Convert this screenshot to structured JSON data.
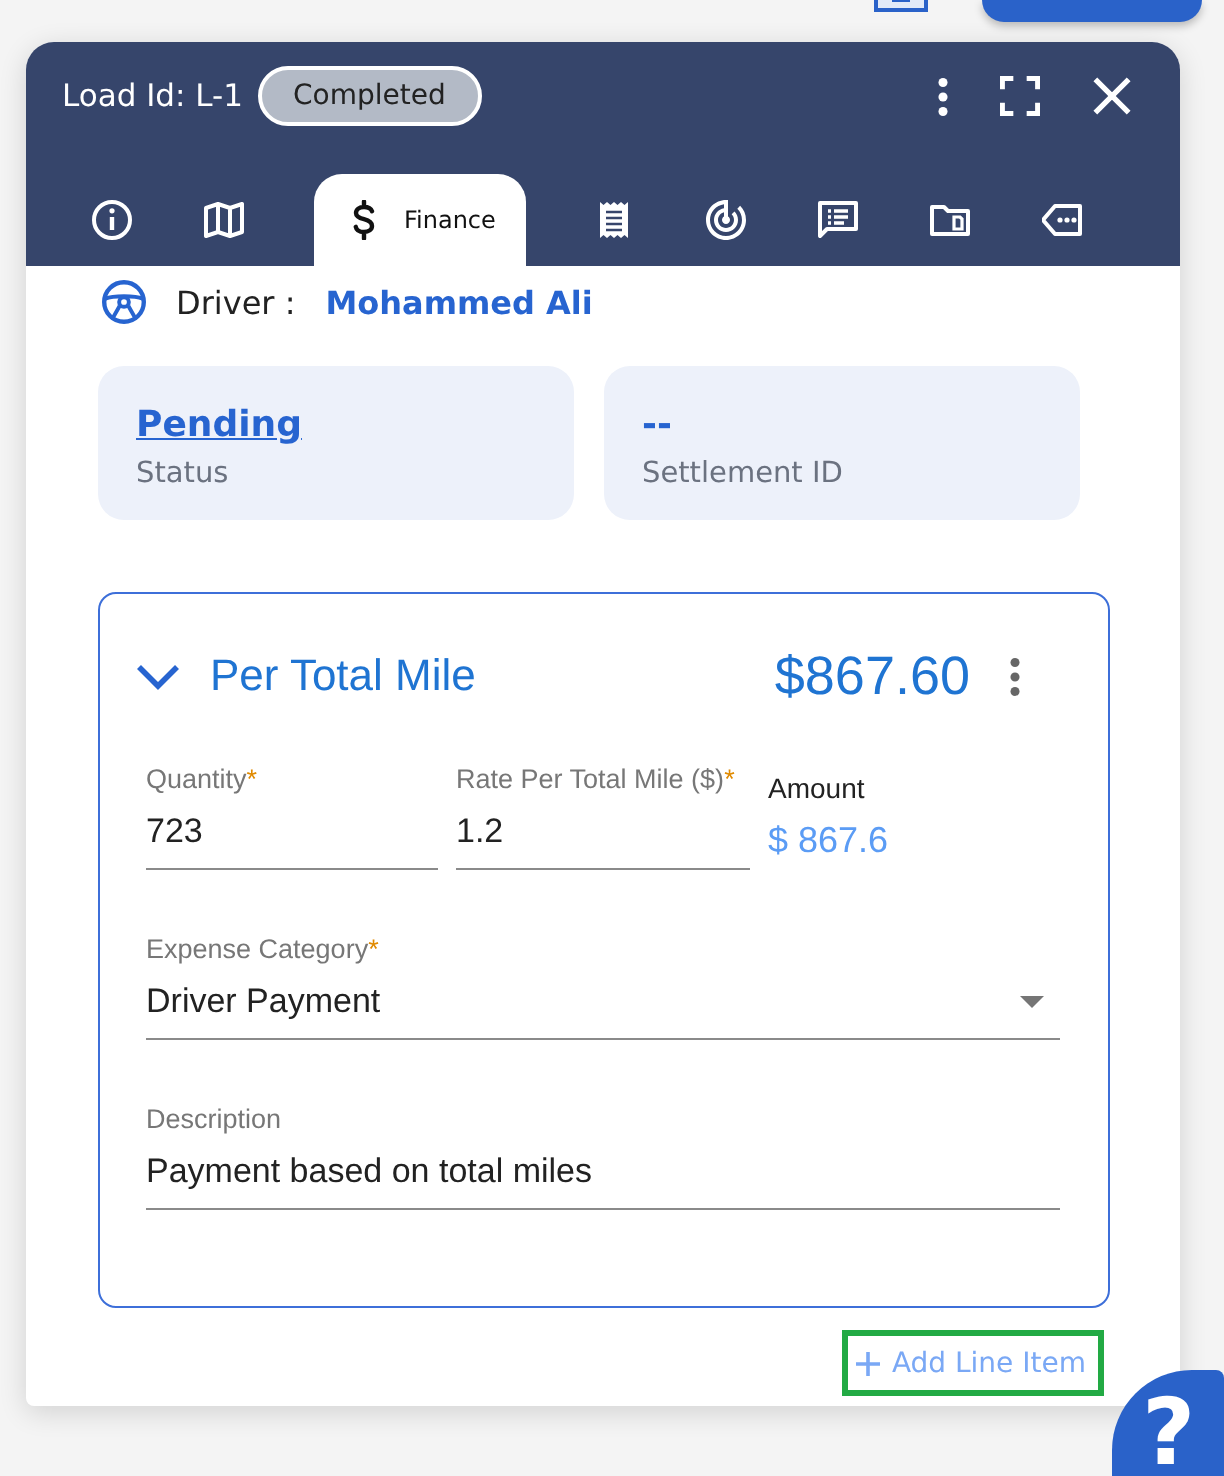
{
  "panel": {
    "title": "Load Id: L-1",
    "status_badge": "Completed",
    "tabs": [
      {
        "selected": false
      },
      {
        "selected": false
      },
      {
        "label": "Finance",
        "selected": true
      },
      {
        "selected": false
      },
      {
        "selected": false
      },
      {
        "selected": false
      },
      {
        "selected": false
      },
      {
        "selected": false
      }
    ]
  },
  "driver": {
    "label": "Driver :",
    "name": "Mohammed Ali"
  },
  "summary": [
    {
      "kind": "link",
      "value": "Pending",
      "label": "Status"
    },
    {
      "kind": "plain",
      "value": "--",
      "label": "Settlement ID"
    }
  ],
  "line_item": {
    "expanded": true,
    "title": "Per Total Mile",
    "total": "$867.60",
    "field_rows": [
      [
        {
          "kind": "text",
          "label": "Quantity",
          "required_mark": "*",
          "value": "723"
        },
        {
          "kind": "text",
          "label": "Rate Per Total Mile ($)",
          "required_mark": "*",
          "value": "1.2"
        },
        {
          "kind": "readout",
          "label": "Amount",
          "value": "$ 867.6"
        }
      ],
      [
        {
          "kind": "select",
          "label": "Expense Category",
          "required_mark": "*",
          "value": "Driver Payment"
        }
      ],
      [
        {
          "kind": "text",
          "label": "Description",
          "value": "Payment based on total miles"
        }
      ]
    ]
  },
  "add_line_item": {
    "label": "Add Line Item",
    "highlighted": true
  },
  "help_button": {
    "label": "?"
  }
}
